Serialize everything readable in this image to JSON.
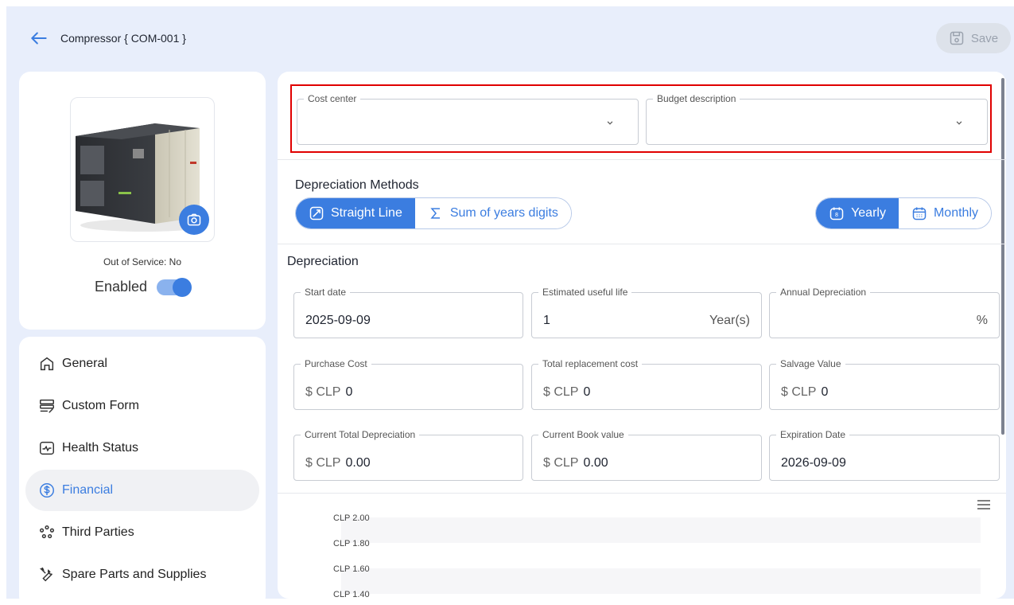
{
  "header": {
    "title": "Compressor { COM-001 }",
    "save_label": "Save"
  },
  "profile": {
    "out_of_service": "Out of Service: No",
    "enabled_label": "Enabled",
    "enabled": true
  },
  "nav": {
    "items": [
      {
        "label": "General",
        "icon": "home-icon"
      },
      {
        "label": "Custom Form",
        "icon": "form-icon"
      },
      {
        "label": "Health Status",
        "icon": "health-icon"
      },
      {
        "label": "Financial",
        "icon": "dollar-icon",
        "active": true
      },
      {
        "label": "Third Parties",
        "icon": "people-icon"
      },
      {
        "label": "Spare Parts and Supplies",
        "icon": "tools-icon"
      }
    ]
  },
  "top_fields": {
    "cost_center": {
      "label": "Cost center",
      "value": ""
    },
    "budget_description": {
      "label": "Budget description",
      "value": ""
    }
  },
  "methods": {
    "title": "Depreciation Methods",
    "straight_line": "Straight Line",
    "sum_of_years": "Sum of years digits",
    "yearly": "Yearly",
    "monthly": "Monthly"
  },
  "depreciation": {
    "title": "Depreciation",
    "start_date": {
      "label": "Start date",
      "value": "2025-09-09"
    },
    "useful_life": {
      "label": "Estimated useful life",
      "value": "1",
      "suffix": "Year(s)"
    },
    "annual_depreciation": {
      "label": "Annual Depreciation",
      "value": "",
      "suffix": "%"
    },
    "purchase_cost": {
      "label": "Purchase Cost",
      "prefix": "$ CLP",
      "value": "0"
    },
    "replacement_cost": {
      "label": "Total replacement cost",
      "prefix": "$ CLP",
      "value": "0"
    },
    "salvage_value": {
      "label": "Salvage Value",
      "prefix": "$ CLP",
      "value": "0"
    },
    "current_total_depreciation": {
      "label": "Current Total Depreciation",
      "prefix": "$ CLP",
      "value": "0.00"
    },
    "current_book_value": {
      "label": "Current Book value",
      "prefix": "$ CLP",
      "value": "0.00"
    },
    "expiration_date": {
      "label": "Expiration Date",
      "value": "2026-09-09"
    }
  },
  "chart_data": {
    "type": "line",
    "ytick_labels": [
      "CLP 2.00",
      "CLP 1.80",
      "CLP 1.60",
      "CLP 1.40"
    ]
  },
  "colors": {
    "accent": "#3b7de0",
    "background": "#e8eefb",
    "highlight": "#e00000"
  }
}
